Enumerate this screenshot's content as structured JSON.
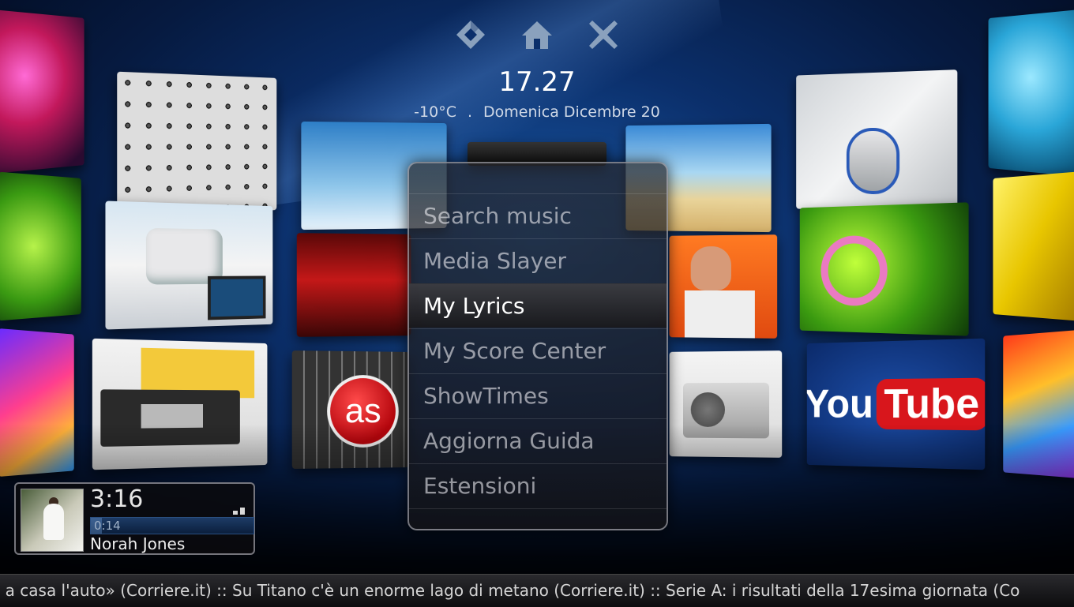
{
  "header": {
    "icons": [
      "back-icon",
      "home-icon",
      "close-icon"
    ],
    "time": "17.27",
    "temperature": "-10°C",
    "separator": ".",
    "date": "Domenica Dicembre 20"
  },
  "menu": {
    "items": [
      {
        "label": "Search music"
      },
      {
        "label": "Media Slayer"
      },
      {
        "label": "My Lyrics",
        "focused": true
      },
      {
        "label": "My Score Center"
      },
      {
        "label": "ShowTimes"
      },
      {
        "label": "Aggiorna Guida"
      },
      {
        "label": "Estensioni"
      }
    ]
  },
  "now_playing": {
    "duration": "3:16",
    "elapsed": "0:14",
    "artist": "Norah Jones",
    "progress": 0.07
  },
  "tiles": {
    "youtube_you": "You",
    "youtube_tube": "Tube",
    "lastfm_glyph": "as"
  },
  "ticker": {
    "text": "e a casa l'auto» (Corriere.it) :: Su Titano c'è un enorme lago di metano (Corriere.it) :: Serie A: i risultati della 17esima giornata (Co"
  },
  "colors": {
    "background": "#0b2f6b",
    "focus_text": "#ffffff",
    "dim_text": "#e6e6eb",
    "youtube_red": "#d8161c",
    "lastfm_red": "#d51007"
  }
}
